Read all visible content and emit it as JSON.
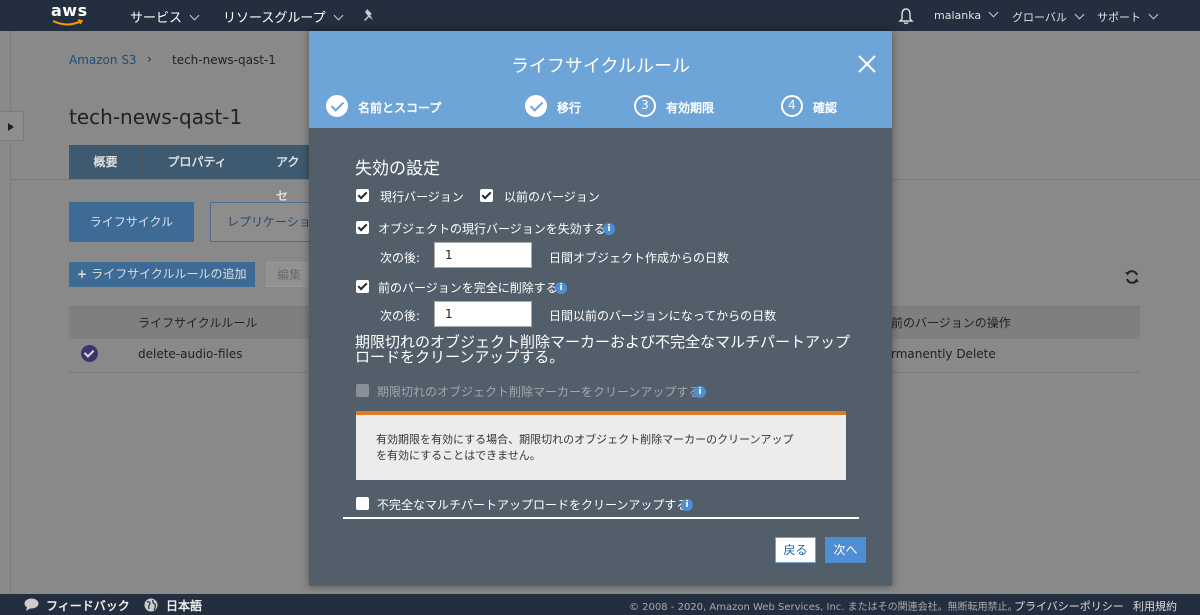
{
  "topnav": {
    "logo": "aws",
    "services": "サービス",
    "resource_groups": "リソースグループ",
    "user": "malanka",
    "region": "グローバル",
    "support": "サポート"
  },
  "page": {
    "breadcrumb_root": "Amazon S3",
    "breadcrumb_sep": "›",
    "breadcrumb_current": "tech-news-qast-1",
    "title": "tech-news-qast-1",
    "tabs": [
      "概要",
      "プロパティ",
      "アクセ"
    ],
    "lifecycle_button": "ライフサイクル",
    "replication_button": "レプリケーショ",
    "add_rule_button": "ライフサイクルルールの追加",
    "edit_button": "編集",
    "table": {
      "columns": [
        "ライフサイクルルール",
        "前のバージョンの操作"
      ],
      "rows": [
        {
          "name": "delete-audio-files",
          "action": "rmanently Delete"
        }
      ]
    }
  },
  "modal": {
    "title": "ライフサイクルルール",
    "steps": [
      {
        "label": "名前とスコープ",
        "state": "done"
      },
      {
        "label": "移行",
        "state": "done"
      },
      {
        "num": "3",
        "label": "有効期限",
        "state": "current"
      },
      {
        "num": "4",
        "label": "確認",
        "state": "todo"
      }
    ],
    "section_title": "失効の設定",
    "current_version_label": "現行バージョン",
    "previous_version_label": "以前のバージョン",
    "expire_current_label": "オブジェクトの現行バージョンを失効する",
    "after_label": "次の後:",
    "expire_current_value": "1",
    "expire_current_unit": "日間オブジェクト作成からの日数",
    "delete_previous_label": "前のバージョンを完全に削除する",
    "delete_previous_value": "1",
    "delete_previous_unit": "日間以前のバージョンになってからの日数",
    "cleanup_title_line1": "期限切れのオブジェクト削除マーカーおよび不完全なマルチパートアップ",
    "cleanup_title_line2": "ロードをクリーンアップする。",
    "cleanup_markers_label": "期限切れのオブジェクト削除マーカーをクリーンアップする",
    "warning_line1": "有効期限を有効にする場合、期限切れのオブジェクト削除マーカーのクリーンアップ",
    "warning_line2": "を有効にすることはできません。",
    "cleanup_multipart_label": "不完全なマルチパートアップロードをクリーンアップする",
    "back_button": "戻る",
    "next_button": "次へ",
    "info_glyph": "i"
  },
  "footer": {
    "feedback": "フィードバック",
    "language": "日本語",
    "copyright": "© 2008 - 2020, Amazon Web Services, Inc. またはその関連会社。無断転用禁止。",
    "privacy": "プライバシーポリシー",
    "terms": "利用規約"
  },
  "colors": {
    "nav_bg": "#232f3e",
    "modal_header": "#6ea5d9",
    "modal_body": "#525f6b",
    "primary_button": "#4f8ed3",
    "warning_accent": "#e07b24"
  }
}
